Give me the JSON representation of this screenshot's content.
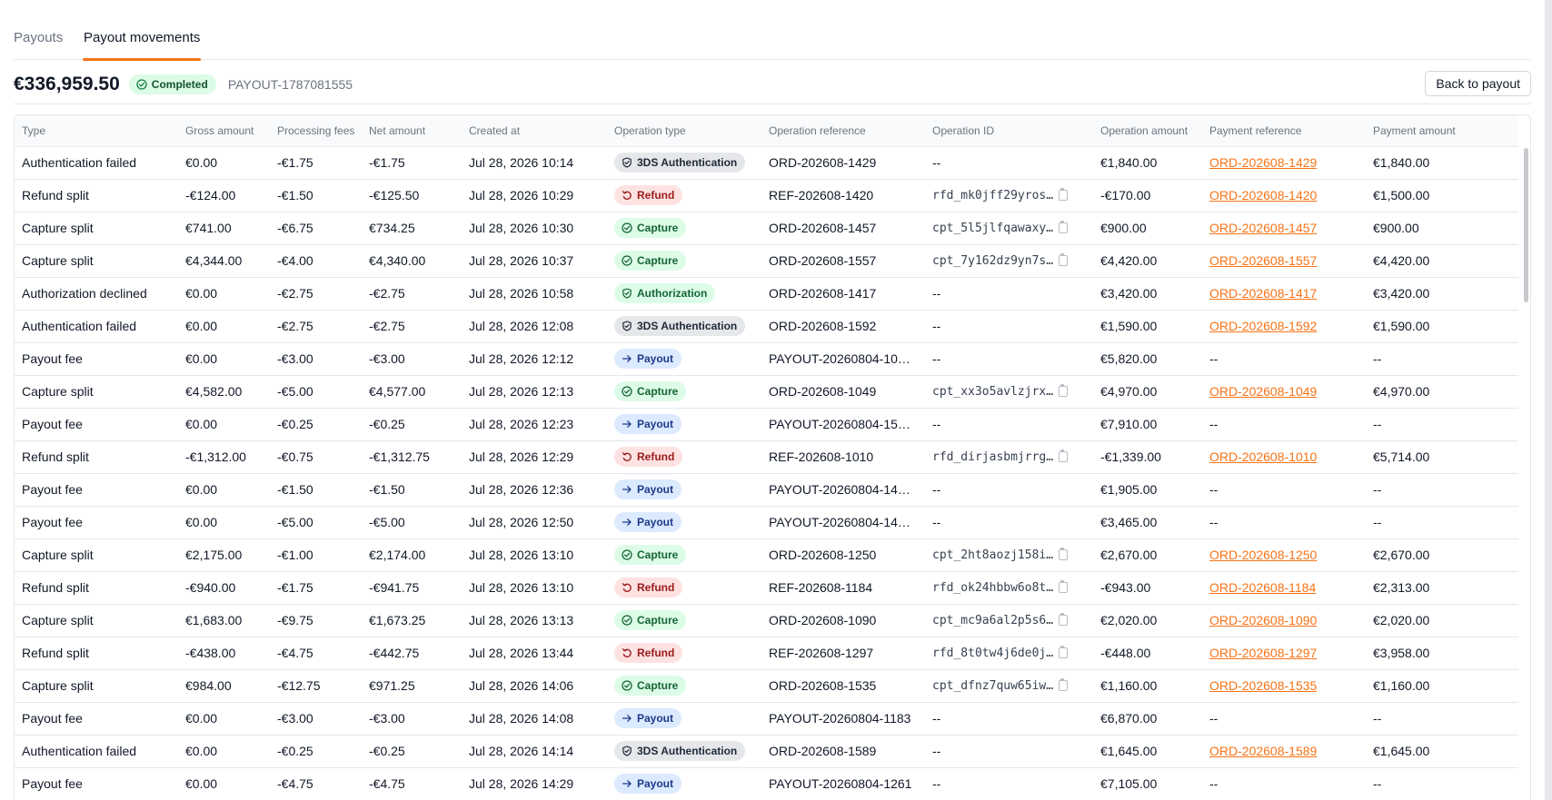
{
  "tabs": [
    {
      "label": "Payouts",
      "active": false
    },
    {
      "label": "Payout movements",
      "active": true
    }
  ],
  "summary": {
    "amount": "€336,959.50",
    "status": "Completed",
    "payout_id": "PAYOUT-1787081555",
    "back_label": "Back to payout"
  },
  "colors": {
    "accent": "#f97316",
    "link": "#f97316"
  },
  "table": {
    "columns": [
      "Type",
      "Gross amount",
      "Processing fees",
      "Net amount",
      "Created at",
      "Operation type",
      "Operation reference",
      "Operation ID",
      "Operation amount",
      "Payment reference",
      "Payment amount"
    ],
    "rows": [
      {
        "type": "Authentication failed",
        "gross": "€0.00",
        "fees": "-€1.75",
        "net": "-€1.75",
        "created": "Jul 28, 2026 10:14",
        "op_type": "3DS Authentication",
        "op_kind": "threeds",
        "op_ref": "ORD-202608-1429",
        "op_id": "--",
        "op_amount": "€1,840.00",
        "pay_ref": "ORD-202608-1429",
        "pay_amount": "€1,840.00"
      },
      {
        "type": "Refund split",
        "gross": "-€124.00",
        "fees": "-€1.50",
        "net": "-€125.50",
        "created": "Jul 28, 2026 10:29",
        "op_type": "Refund",
        "op_kind": "refund",
        "op_ref": "REF-202608-1420",
        "op_id": "rfd_mk0jff29yros…",
        "op_amount": "-€170.00",
        "pay_ref": "ORD-202608-1420",
        "pay_amount": "€1,500.00"
      },
      {
        "type": "Capture split",
        "gross": "€741.00",
        "fees": "-€6.75",
        "net": "€734.25",
        "created": "Jul 28, 2026 10:30",
        "op_type": "Capture",
        "op_kind": "capture",
        "op_ref": "ORD-202608-1457",
        "op_id": "cpt_5l5jlfqawaxy…",
        "op_amount": "€900.00",
        "pay_ref": "ORD-202608-1457",
        "pay_amount": "€900.00"
      },
      {
        "type": "Capture split",
        "gross": "€4,344.00",
        "fees": "-€4.00",
        "net": "€4,340.00",
        "created": "Jul 28, 2026 10:37",
        "op_type": "Capture",
        "op_kind": "capture",
        "op_ref": "ORD-202608-1557",
        "op_id": "cpt_7y162dz9yn7s…",
        "op_amount": "€4,420.00",
        "pay_ref": "ORD-202608-1557",
        "pay_amount": "€4,420.00"
      },
      {
        "type": "Authorization declined",
        "gross": "€0.00",
        "fees": "-€2.75",
        "net": "-€2.75",
        "created": "Jul 28, 2026 10:58",
        "op_type": "Authorization",
        "op_kind": "auth",
        "op_ref": "ORD-202608-1417",
        "op_id": "--",
        "op_amount": "€3,420.00",
        "pay_ref": "ORD-202608-1417",
        "pay_amount": "€3,420.00"
      },
      {
        "type": "Authentication failed",
        "gross": "€0.00",
        "fees": "-€2.75",
        "net": "-€2.75",
        "created": "Jul 28, 2026 12:08",
        "op_type": "3DS Authentication",
        "op_kind": "threeds",
        "op_ref": "ORD-202608-1592",
        "op_id": "--",
        "op_amount": "€1,590.00",
        "pay_ref": "ORD-202608-1592",
        "pay_amount": "€1,590.00"
      },
      {
        "type": "Payout fee",
        "gross": "€0.00",
        "fees": "-€3.00",
        "net": "-€3.00",
        "created": "Jul 28, 2026 12:12",
        "op_type": "Payout",
        "op_kind": "payout",
        "op_ref": "PAYOUT-20260804-10…",
        "op_id": "--",
        "op_amount": "€5,820.00",
        "pay_ref": "--",
        "pay_amount": "--"
      },
      {
        "type": "Capture split",
        "gross": "€4,582.00",
        "fees": "-€5.00",
        "net": "€4,577.00",
        "created": "Jul 28, 2026 12:13",
        "op_type": "Capture",
        "op_kind": "capture",
        "op_ref": "ORD-202608-1049",
        "op_id": "cpt_xx3o5avlzjrx…",
        "op_amount": "€4,970.00",
        "pay_ref": "ORD-202608-1049",
        "pay_amount": "€4,970.00"
      },
      {
        "type": "Payout fee",
        "gross": "€0.00",
        "fees": "-€0.25",
        "net": "-€0.25",
        "created": "Jul 28, 2026 12:23",
        "op_type": "Payout",
        "op_kind": "payout",
        "op_ref": "PAYOUT-20260804-15…",
        "op_id": "--",
        "op_amount": "€7,910.00",
        "pay_ref": "--",
        "pay_amount": "--"
      },
      {
        "type": "Refund split",
        "gross": "-€1,312.00",
        "fees": "-€0.75",
        "net": "-€1,312.75",
        "created": "Jul 28, 2026 12:29",
        "op_type": "Refund",
        "op_kind": "refund",
        "op_ref": "REF-202608-1010",
        "op_id": "rfd_dirjasbmjrrg…",
        "op_amount": "-€1,339.00",
        "pay_ref": "ORD-202608-1010",
        "pay_amount": "€5,714.00"
      },
      {
        "type": "Payout fee",
        "gross": "€0.00",
        "fees": "-€1.50",
        "net": "-€1.50",
        "created": "Jul 28, 2026 12:36",
        "op_type": "Payout",
        "op_kind": "payout",
        "op_ref": "PAYOUT-20260804-14…",
        "op_id": "--",
        "op_amount": "€1,905.00",
        "pay_ref": "--",
        "pay_amount": "--"
      },
      {
        "type": "Payout fee",
        "gross": "€0.00",
        "fees": "-€5.00",
        "net": "-€5.00",
        "created": "Jul 28, 2026 12:50",
        "op_type": "Payout",
        "op_kind": "payout",
        "op_ref": "PAYOUT-20260804-14…",
        "op_id": "--",
        "op_amount": "€3,465.00",
        "pay_ref": "--",
        "pay_amount": "--"
      },
      {
        "type": "Capture split",
        "gross": "€2,175.00",
        "fees": "-€1.00",
        "net": "€2,174.00",
        "created": "Jul 28, 2026 13:10",
        "op_type": "Capture",
        "op_kind": "capture",
        "op_ref": "ORD-202608-1250",
        "op_id": "cpt_2ht8aozj158i…",
        "op_amount": "€2,670.00",
        "pay_ref": "ORD-202608-1250",
        "pay_amount": "€2,670.00"
      },
      {
        "type": "Refund split",
        "gross": "-€940.00",
        "fees": "-€1.75",
        "net": "-€941.75",
        "created": "Jul 28, 2026 13:10",
        "op_type": "Refund",
        "op_kind": "refund",
        "op_ref": "REF-202608-1184",
        "op_id": "rfd_ok24hbbw6o8t…",
        "op_amount": "-€943.00",
        "pay_ref": "ORD-202608-1184",
        "pay_amount": "€2,313.00"
      },
      {
        "type": "Capture split",
        "gross": "€1,683.00",
        "fees": "-€9.75",
        "net": "€1,673.25",
        "created": "Jul 28, 2026 13:13",
        "op_type": "Capture",
        "op_kind": "capture",
        "op_ref": "ORD-202608-1090",
        "op_id": "cpt_mc9a6al2p5s6…",
        "op_amount": "€2,020.00",
        "pay_ref": "ORD-202608-1090",
        "pay_amount": "€2,020.00"
      },
      {
        "type": "Refund split",
        "gross": "-€438.00",
        "fees": "-€4.75",
        "net": "-€442.75",
        "created": "Jul 28, 2026 13:44",
        "op_type": "Refund",
        "op_kind": "refund",
        "op_ref": "REF-202608-1297",
        "op_id": "rfd_8t0tw4j6de0j…",
        "op_amount": "-€448.00",
        "pay_ref": "ORD-202608-1297",
        "pay_amount": "€3,958.00"
      },
      {
        "type": "Capture split",
        "gross": "€984.00",
        "fees": "-€12.75",
        "net": "€971.25",
        "created": "Jul 28, 2026 14:06",
        "op_type": "Capture",
        "op_kind": "capture",
        "op_ref": "ORD-202608-1535",
        "op_id": "cpt_dfnz7quw65iw…",
        "op_amount": "€1,160.00",
        "pay_ref": "ORD-202608-1535",
        "pay_amount": "€1,160.00"
      },
      {
        "type": "Payout fee",
        "gross": "€0.00",
        "fees": "-€3.00",
        "net": "-€3.00",
        "created": "Jul 28, 2026 14:08",
        "op_type": "Payout",
        "op_kind": "payout",
        "op_ref": "PAYOUT-20260804-1183",
        "op_id": "--",
        "op_amount": "€6,870.00",
        "pay_ref": "--",
        "pay_amount": "--"
      },
      {
        "type": "Authentication failed",
        "gross": "€0.00",
        "fees": "-€0.25",
        "net": "-€0.25",
        "created": "Jul 28, 2026 14:14",
        "op_type": "3DS Authentication",
        "op_kind": "threeds",
        "op_ref": "ORD-202608-1589",
        "op_id": "--",
        "op_amount": "€1,645.00",
        "pay_ref": "ORD-202608-1589",
        "pay_amount": "€1,645.00"
      },
      {
        "type": "Payout fee",
        "gross": "€0.00",
        "fees": "-€4.75",
        "net": "-€4.75",
        "created": "Jul 28, 2026 14:29",
        "op_type": "Payout",
        "op_kind": "payout",
        "op_ref": "PAYOUT-20260804-1261",
        "op_id": "--",
        "op_amount": "€7,105.00",
        "pay_ref": "--",
        "pay_amount": "--"
      }
    ]
  }
}
